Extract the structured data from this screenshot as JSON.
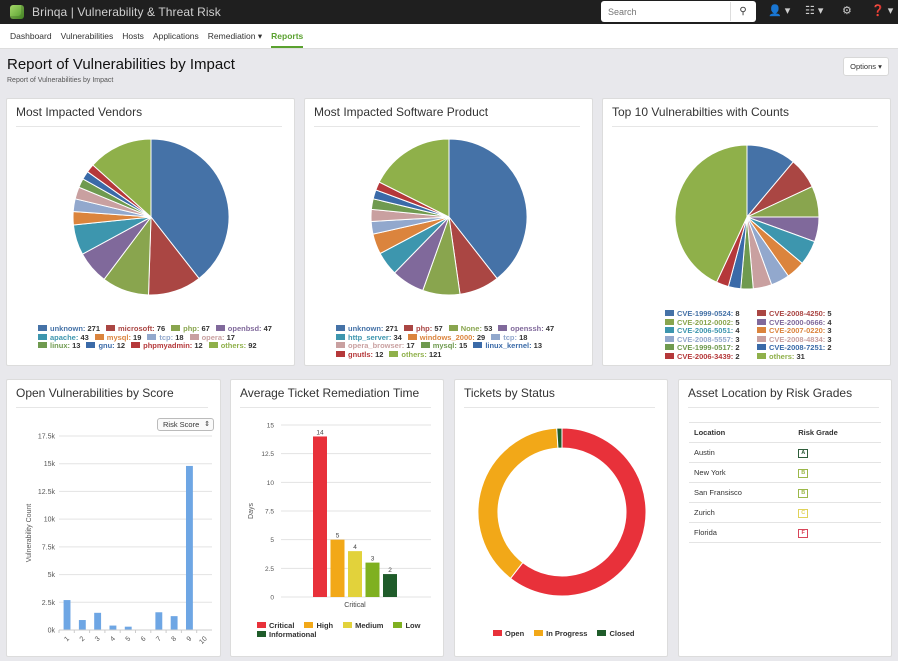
{
  "app": {
    "title": "Brinqa | Vulnerability & Threat Risk",
    "search_placeholder": "Search",
    "icons": [
      "search-icon",
      "user-icon",
      "apps-grid-icon",
      "gear-icon",
      "help-icon"
    ]
  },
  "nav": {
    "items": [
      {
        "label": "Dashboard",
        "active": false
      },
      {
        "label": "Vulnerabilities",
        "active": false
      },
      {
        "label": "Hosts",
        "active": false
      },
      {
        "label": "Applications",
        "active": false
      },
      {
        "label": "Remediation ▾",
        "active": false
      },
      {
        "label": "Reports",
        "active": true
      }
    ]
  },
  "page": {
    "title": "Report of Vulnerabilities by Impact",
    "subtitle": "Report of Vulnerabilities by Impact",
    "options_label": "Options ▾"
  },
  "colors": {
    "palette": [
      "#4572a7",
      "#aa4643",
      "#89a54e",
      "#80699b",
      "#3d96ae",
      "#db843d",
      "#92a8cd",
      "#a47d7c",
      "#6f9a4f",
      "#3a6aa8",
      "#b5383a",
      "#8fb04a"
    ],
    "accent": "#5aa12f"
  },
  "chart_data": [
    {
      "id": "vendors",
      "type": "pie",
      "title": "Most Impacted Vendors",
      "legend_position": "bottom",
      "slices": [
        {
          "label": "unknown",
          "value": 271,
          "color": "#4572a7"
        },
        {
          "label": "microsoft",
          "value": 76,
          "color": "#aa4643"
        },
        {
          "label": "php",
          "value": 67,
          "color": "#89a54e"
        },
        {
          "label": "openbsd",
          "value": 47,
          "color": "#80699b"
        },
        {
          "label": "apache",
          "value": 43,
          "color": "#3d96ae"
        },
        {
          "label": "mysql",
          "value": 19,
          "color": "#db843d"
        },
        {
          "label": "tcp",
          "value": 18,
          "color": "#92a8cd"
        },
        {
          "label": "opera",
          "value": 17,
          "color": "#c9a0a0"
        },
        {
          "label": "linux",
          "value": 13,
          "color": "#6f9a4f"
        },
        {
          "label": "gnu",
          "value": 12,
          "color": "#3a6aa8"
        },
        {
          "label": "phpmyadmin",
          "value": 12,
          "color": "#b5383a"
        },
        {
          "label": "others",
          "value": 92,
          "color": "#8fb04a"
        }
      ]
    },
    {
      "id": "software",
      "type": "pie",
      "title": "Most Impacted Software Product",
      "legend_position": "bottom",
      "slices": [
        {
          "label": "unknown",
          "value": 271,
          "color": "#4572a7"
        },
        {
          "label": "php",
          "value": 57,
          "color": "#aa4643"
        },
        {
          "label": "None",
          "value": 53,
          "color": "#89a54e"
        },
        {
          "label": "openssh",
          "value": 47,
          "color": "#80699b"
        },
        {
          "label": "http_server",
          "value": 34,
          "color": "#3d96ae"
        },
        {
          "label": "windows_2000",
          "value": 29,
          "color": "#db843d"
        },
        {
          "label": "tcp",
          "value": 18,
          "color": "#92a8cd"
        },
        {
          "label": "opera_browser",
          "value": 17,
          "color": "#c9a0a0"
        },
        {
          "label": "mysql",
          "value": 15,
          "color": "#6f9a4f"
        },
        {
          "label": "linux_kernel",
          "value": 13,
          "color": "#3a6aa8"
        },
        {
          "label": "gnutls",
          "value": 12,
          "color": "#b5383a"
        },
        {
          "label": "others",
          "value": 121,
          "color": "#8fb04a"
        }
      ]
    },
    {
      "id": "top10",
      "type": "pie",
      "title": "Top 10 Vulnerabilties with Counts",
      "legend_position": "bottom",
      "slices": [
        {
          "label": "CVE-1999-0524",
          "value": 8,
          "color": "#4572a7"
        },
        {
          "label": "CVE-2008-4250",
          "value": 5,
          "color": "#aa4643"
        },
        {
          "label": "CVE-2012-0002",
          "value": 5,
          "color": "#89a54e"
        },
        {
          "label": "CVE-2000-0666",
          "value": 4,
          "color": "#80699b"
        },
        {
          "label": "CVE-2006-5051",
          "value": 4,
          "color": "#3d96ae"
        },
        {
          "label": "CVE-2007-0220",
          "value": 3,
          "color": "#db843d"
        },
        {
          "label": "CVE-2008-5557",
          "value": 3,
          "color": "#92a8cd"
        },
        {
          "label": "CVE-2008-4834",
          "value": 3,
          "color": "#c9a0a0"
        },
        {
          "label": "CVE-1999-0517",
          "value": 2,
          "color": "#6f9a4f"
        },
        {
          "label": "CVE-2008-7251",
          "value": 2,
          "color": "#3a6aa8"
        },
        {
          "label": "CVE-2006-3439",
          "value": 2,
          "color": "#b5383a"
        },
        {
          "label": "others",
          "value": 31,
          "color": "#8fb04a"
        }
      ]
    },
    {
      "id": "score",
      "type": "bar",
      "title": "Open Vulnerabilities by Score",
      "dropdown_label": "Risk Score",
      "categories": [
        "1",
        "2",
        "3",
        "4",
        "5",
        "6",
        "7",
        "8",
        "9",
        "10"
      ],
      "values": [
        2700,
        900,
        1550,
        400,
        300,
        0,
        1600,
        1250,
        14800,
        0
      ],
      "xlabel": "",
      "ylabel": "Vulnerability Count",
      "ylim": [
        0,
        17500
      ],
      "yticks": [
        "0k",
        "2.5k",
        "5k",
        "7.5k",
        "10k",
        "12.5k",
        "15k",
        "17.5k"
      ],
      "color": "#6ea6e4",
      "grid": true
    },
    {
      "id": "remediation",
      "type": "bar",
      "title": "Average Ticket Remediation Time",
      "categories": [
        "Critical"
      ],
      "series": [
        {
          "name": "Critical",
          "values": [
            14
          ],
          "color": "#e8313a"
        },
        {
          "name": "High",
          "values": [
            5
          ],
          "color": "#f2a818"
        },
        {
          "name": "Medium",
          "values": [
            4
          ],
          "color": "#e2d23b"
        },
        {
          "name": "Low",
          "values": [
            3
          ],
          "color": "#7fb020"
        },
        {
          "name": "Informational",
          "values": [
            2
          ],
          "color": "#1f5c2a"
        }
      ],
      "xlabel": "Critical",
      "ylabel": "Days",
      "ylim": [
        0,
        15
      ],
      "yticks": [
        "0",
        "2.5",
        "5",
        "7.5",
        "10",
        "12.5",
        "15"
      ],
      "legend_position": "bottom",
      "grid": true
    },
    {
      "id": "status",
      "type": "pie",
      "title": "Tickets by Status",
      "donut": true,
      "slices": [
        {
          "label": "Open",
          "value": 60.5,
          "color": "#e8313a"
        },
        {
          "label": "In Progress",
          "value": 38.5,
          "color": "#f2a818"
        },
        {
          "label": "Closed",
          "value": 1,
          "color": "#1f5c2a"
        }
      ],
      "legend_position": "bottom"
    }
  ],
  "risk_table": {
    "title": "Asset Location by Risk Grades",
    "headers": [
      "Location",
      "Risk Grade"
    ],
    "rows": [
      {
        "location": "Austin",
        "grade": "A",
        "color": "#2f5d3a"
      },
      {
        "location": "New York",
        "grade": "B",
        "color": "#9cb84a"
      },
      {
        "location": "San Fransisco",
        "grade": "B",
        "color": "#9cb84a"
      },
      {
        "location": "Zurich",
        "grade": "C",
        "color": "#e0d35a"
      },
      {
        "location": "Florida",
        "grade": "F",
        "color": "#d9465a"
      }
    ]
  }
}
